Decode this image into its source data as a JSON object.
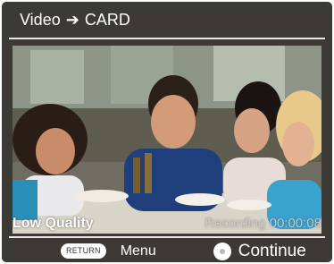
{
  "header": {
    "source_label": "Video",
    "arrow_icon": "arrow-right-icon",
    "destination_label": "CARD"
  },
  "preview": {
    "description_icon": "video-preview"
  },
  "status": {
    "quality": "Low Quality",
    "recording": "Recording 00:00:08"
  },
  "footer": {
    "return_label": "RETURN",
    "menu_label": "Menu",
    "continue_label": "Continue"
  },
  "colors": {
    "frame_background": "#3d3a36",
    "text": "#ffffff",
    "recording_text": "#c9c9c9"
  }
}
